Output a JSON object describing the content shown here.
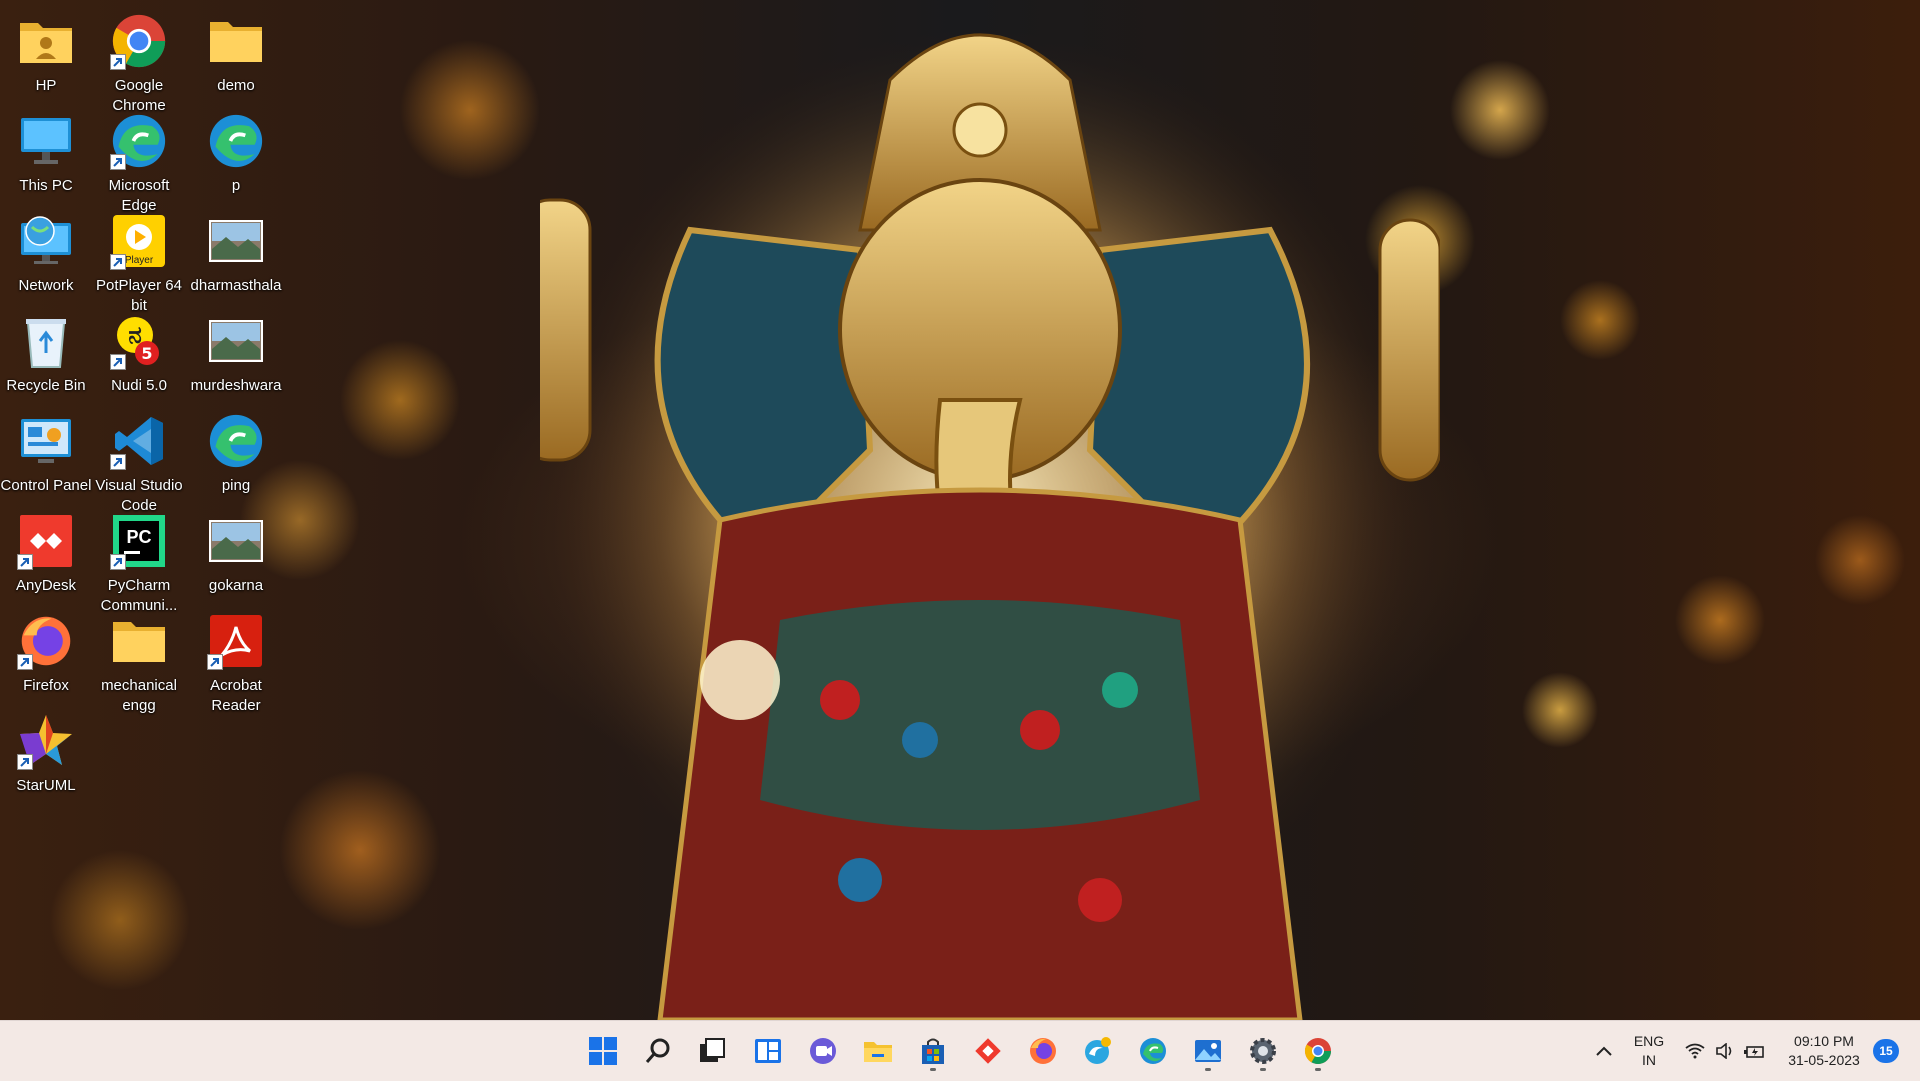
{
  "desktop": {
    "icons": [
      {
        "label": "HP",
        "icon": "user-folder-icon",
        "shortcut": false
      },
      {
        "label": "Google Chrome",
        "icon": "chrome-icon",
        "shortcut": true
      },
      {
        "label": "demo",
        "icon": "folder-icon",
        "shortcut": false
      },
      {
        "label": "This PC",
        "icon": "monitor-icon",
        "shortcut": false
      },
      {
        "label": "Microsoft Edge",
        "icon": "edge-icon",
        "shortcut": true
      },
      {
        "label": "p",
        "icon": "edge-icon",
        "shortcut": false
      },
      {
        "label": "Network",
        "icon": "network-icon",
        "shortcut": false
      },
      {
        "label": "PotPlayer 64 bit",
        "icon": "potplayer-icon",
        "shortcut": true
      },
      {
        "label": "dharmasthala",
        "icon": "image-thumbnail-icon",
        "shortcut": false
      },
      {
        "label": "Recycle Bin",
        "icon": "recycle-bin-icon",
        "shortcut": false
      },
      {
        "label": "Nudi 5.0",
        "icon": "nudi-icon",
        "shortcut": true
      },
      {
        "label": "murdeshwara",
        "icon": "image-thumbnail-icon",
        "shortcut": false
      },
      {
        "label": "Control Panel",
        "icon": "control-panel-icon",
        "shortcut": false
      },
      {
        "label": "Visual Studio Code",
        "icon": "vscode-icon",
        "shortcut": true
      },
      {
        "label": "ping",
        "icon": "edge-icon",
        "shortcut": false
      },
      {
        "label": "AnyDesk",
        "icon": "anydesk-icon",
        "shortcut": true
      },
      {
        "label": "PyCharm Communi...",
        "icon": "pycharm-icon",
        "shortcut": true
      },
      {
        "label": "gokarna",
        "icon": "image-thumbnail-icon",
        "shortcut": false
      },
      {
        "label": "Firefox",
        "icon": "firefox-icon",
        "shortcut": true
      },
      {
        "label": "mechanical engg",
        "icon": "folder-icon",
        "shortcut": false
      },
      {
        "label": "Acrobat Reader",
        "icon": "acrobat-icon",
        "shortcut": true
      },
      {
        "label": "StarUML",
        "icon": "staruml-icon",
        "shortcut": true
      }
    ]
  },
  "taskbar": {
    "apps": [
      "start-icon",
      "search-icon",
      "task-view-icon",
      "widgets-icon",
      "teams-chat-icon",
      "file-explorer-icon",
      "microsoft-store-icon",
      "anydesk-icon",
      "firefox-icon",
      "edge-beta-icon",
      "edge-icon",
      "photos-icon",
      "settings-icon",
      "chrome-icon"
    ],
    "language_line1": "ENG",
    "language_line2": "IN",
    "time": "09:10 PM",
    "date": "31-05-2023",
    "notification_count": "15"
  },
  "colors": {
    "taskbar_bg": "#f2e8e4",
    "accent": "#1a73e8"
  }
}
